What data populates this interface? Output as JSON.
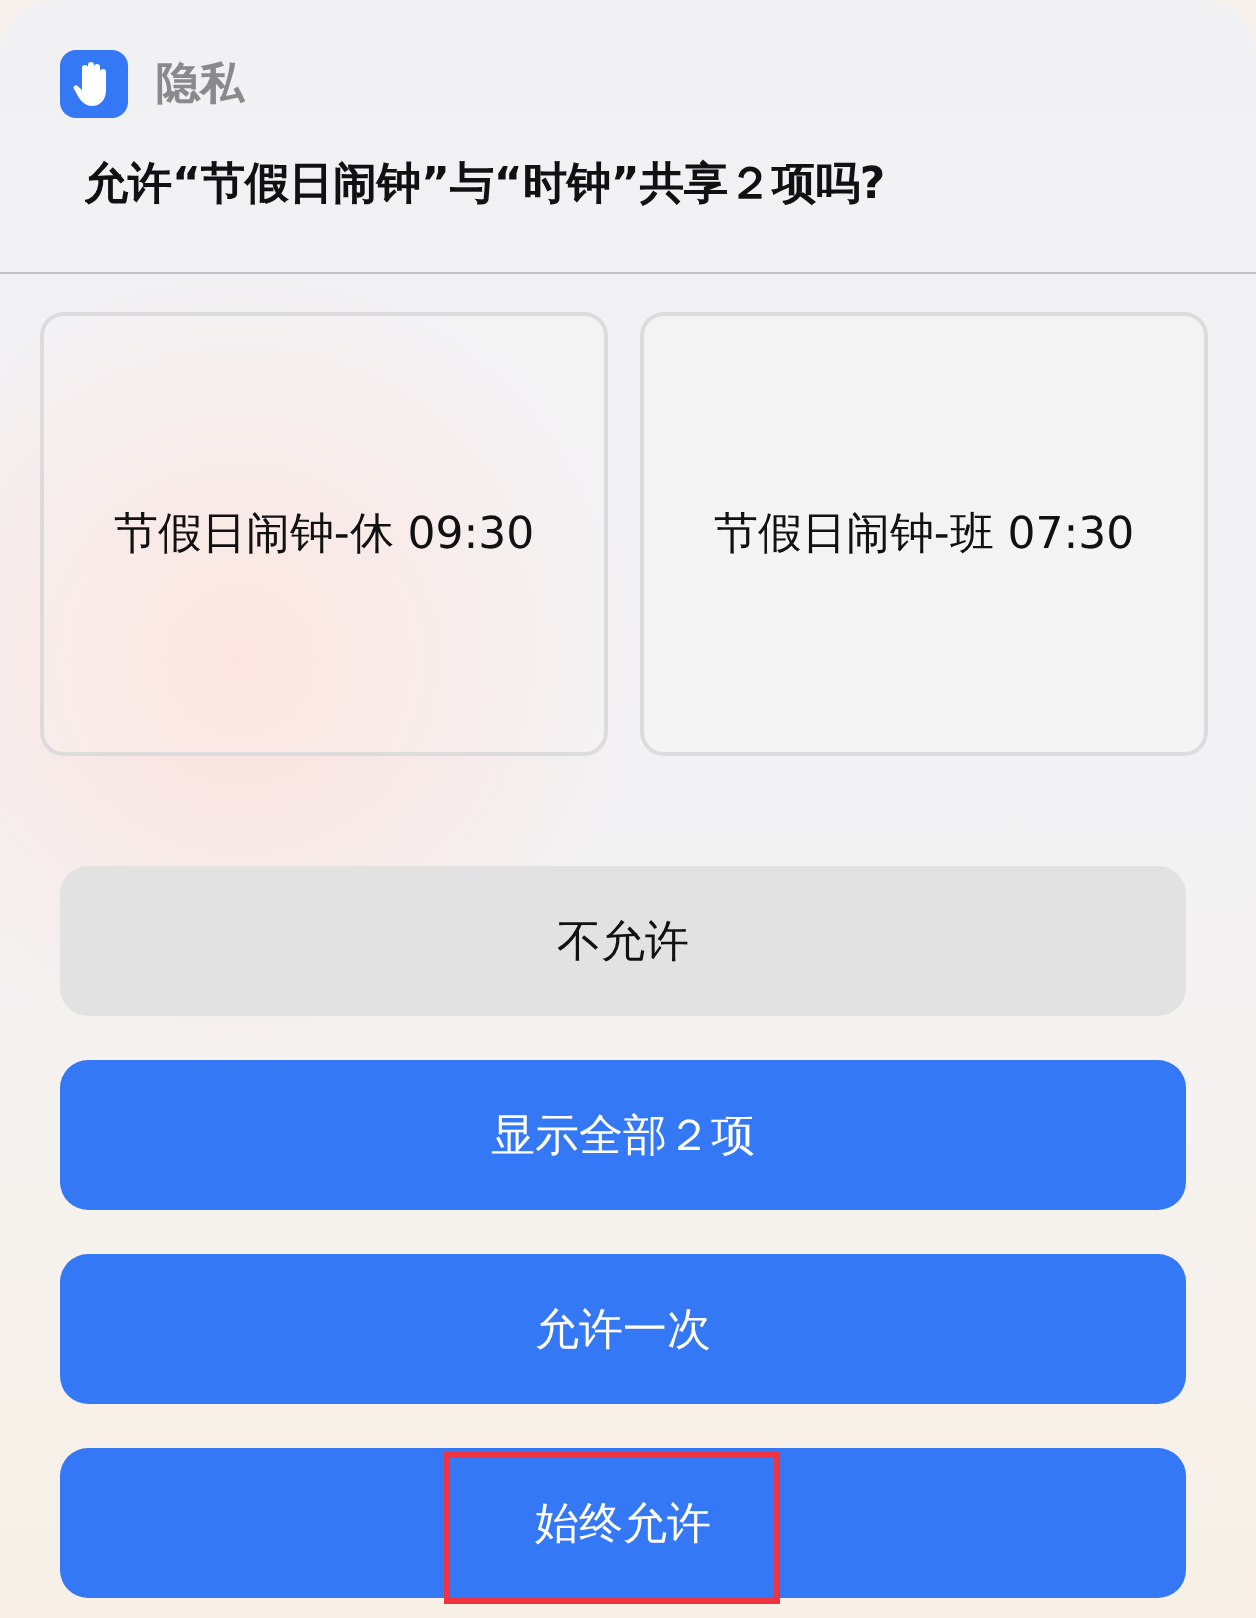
{
  "header": {
    "app_name": "隐私"
  },
  "title": "允许“节假日闹钟”与“时钟”共享２项吗?",
  "items": [
    {
      "label": "节假日闹钟-休 09:30"
    },
    {
      "label": "节假日闹钟-班 07:30"
    }
  ],
  "buttons": [
    {
      "label": "不允许",
      "kind": "secondary",
      "highlighted": false
    },
    {
      "label": "显示全部２项",
      "kind": "primary",
      "highlighted": false
    },
    {
      "label": "允许一次",
      "kind": "primary",
      "highlighted": false
    },
    {
      "label": "始终允许",
      "kind": "primary",
      "highlighted": true
    }
  ]
}
